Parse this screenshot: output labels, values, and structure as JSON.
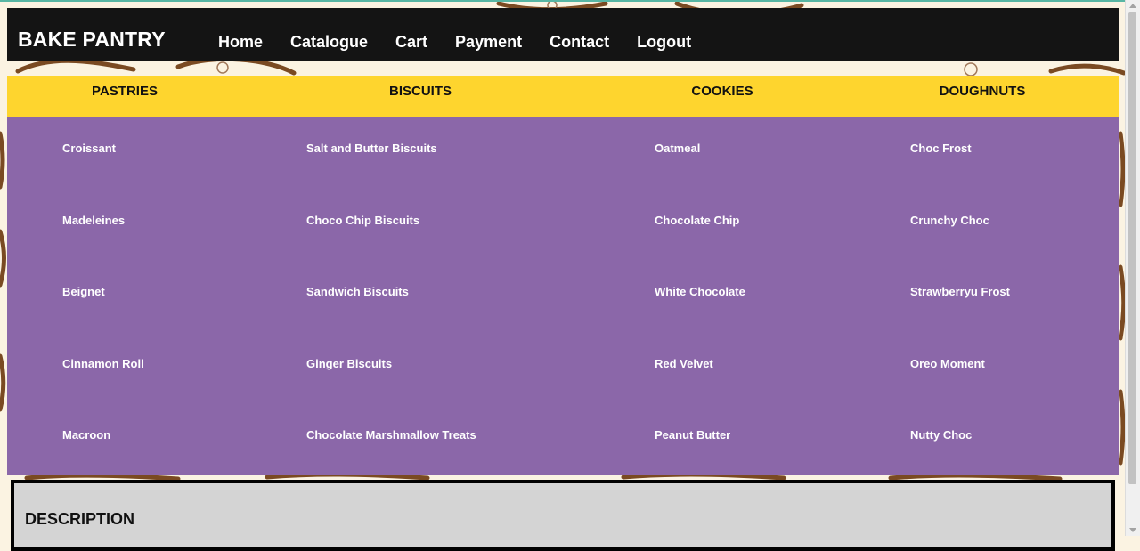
{
  "brand": "BAKE PANTRY",
  "nav": [
    "Home",
    "Catalogue",
    "Cart",
    "Payment",
    "Contact",
    "Logout"
  ],
  "categories": [
    {
      "heading": "PASTRIES",
      "items": [
        "Croissant",
        "Madeleines",
        "Beignet",
        "Cinnamon Roll",
        "Macroon"
      ]
    },
    {
      "heading": "BISCUITS",
      "items": [
        "Salt and Butter Biscuits",
        "Choco Chip Biscuits",
        "Sandwich Biscuits",
        "Ginger Biscuits",
        "Chocolate Marshmallow Treats"
      ]
    },
    {
      "heading": "COOKIES",
      "items": [
        "Oatmeal",
        "Chocolate Chip",
        "White Chocolate",
        "Red Velvet",
        "Peanut Butter"
      ]
    },
    {
      "heading": "DOUGHNUTS",
      "items": [
        "Choc Frost",
        "Crunchy Choc",
        "Strawberryu Frost",
        "Oreo Moment",
        "Nutty Choc"
      ]
    }
  ],
  "description": {
    "title": "DESCRIPTION"
  },
  "colors": {
    "navbar": "#141414",
    "category_bar": "#fed52e",
    "menu_panel": "#8b67a9",
    "description_box": "#d4d4d4"
  }
}
